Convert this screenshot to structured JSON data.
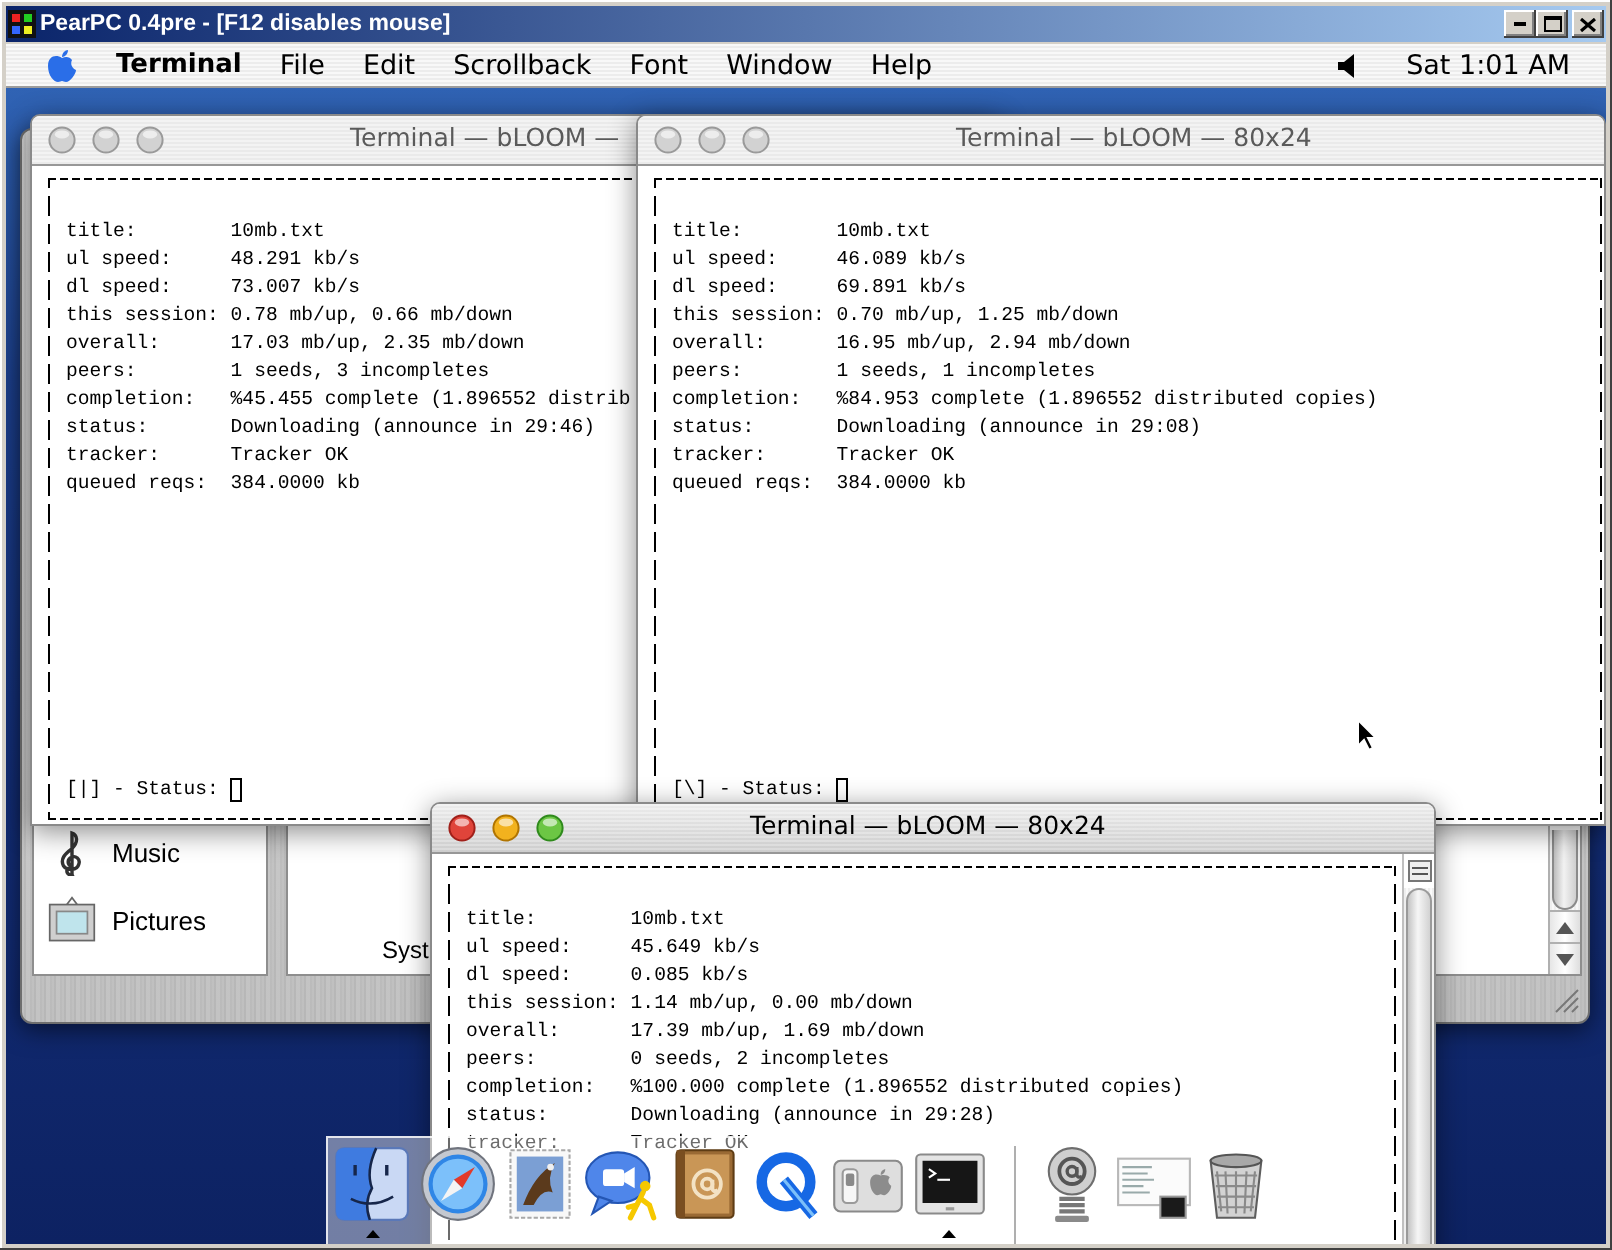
{
  "window": {
    "title": "PearPC 0.4pre - [F12 disables mouse]"
  },
  "menu_bar": {
    "app_name": "Terminal",
    "menus": [
      "File",
      "Edit",
      "Scrollback",
      "Font",
      "Window",
      "Help"
    ],
    "clock": "Sat 1:01 AM"
  },
  "file_browser": {
    "sidebar_items": [
      "Music",
      "Pictures"
    ],
    "item_label": "Syst"
  },
  "terminals": [
    {
      "title": "Terminal — bLOOM —",
      "active": false,
      "lines": [
        "title:        10mb.txt",
        "ul speed:     48.291 kb/s",
        "dl speed:     73.007 kb/s",
        "this session: 0.78 mb/up, 0.66 mb/down",
        "overall:      17.03 mb/up, 2.35 mb/down",
        "peers:        1 seeds, 3 incompletes",
        "completion:   %45.455 complete (1.896552 distrib",
        "status:       Downloading (announce in 29:46)",
        "tracker:      Tracker OK",
        "queued reqs:  384.0000 kb"
      ],
      "status": "[|] - Status:"
    },
    {
      "title": "Terminal — bLOOM — 80x24",
      "active": false,
      "lines": [
        "title:        10mb.txt",
        "ul speed:     46.089 kb/s",
        "dl speed:     69.891 kb/s",
        "this session: 0.70 mb/up, 1.25 mb/down",
        "overall:      16.95 mb/up, 2.94 mb/down",
        "peers:        1 seeds, 1 incompletes",
        "completion:   %84.953 complete (1.896552 distributed copies)",
        "status:       Downloading (announce in 29:08)",
        "tracker:      Tracker OK",
        "queued reqs:  384.0000 kb"
      ],
      "status": "[\\] - Status:"
    },
    {
      "title": "Terminal — bLOOM — 80x24",
      "active": true,
      "lines": [
        "title:        10mb.txt",
        "ul speed:     45.649 kb/s",
        "dl speed:     0.085 kb/s",
        "this session: 1.14 mb/up, 0.00 mb/down",
        "overall:      17.39 mb/up, 1.69 mb/down",
        "peers:        0 seeds, 2 incompletes",
        "completion:   %100.000 complete (1.896552 distributed copies)",
        "status:       Downloading (announce in 29:28)",
        "tracker:      Tracker OK"
      ]
    }
  ],
  "dock": {
    "apps": [
      {
        "running": true
      },
      {
        "running": false
      },
      {
        "running": false
      },
      {
        "running": false
      },
      {
        "running": false
      },
      {
        "running": false
      },
      {
        "running": false
      },
      {
        "running": true
      }
    ],
    "others": [
      {
        "running": false
      },
      {
        "running": false
      },
      {
        "running": false
      }
    ]
  }
}
